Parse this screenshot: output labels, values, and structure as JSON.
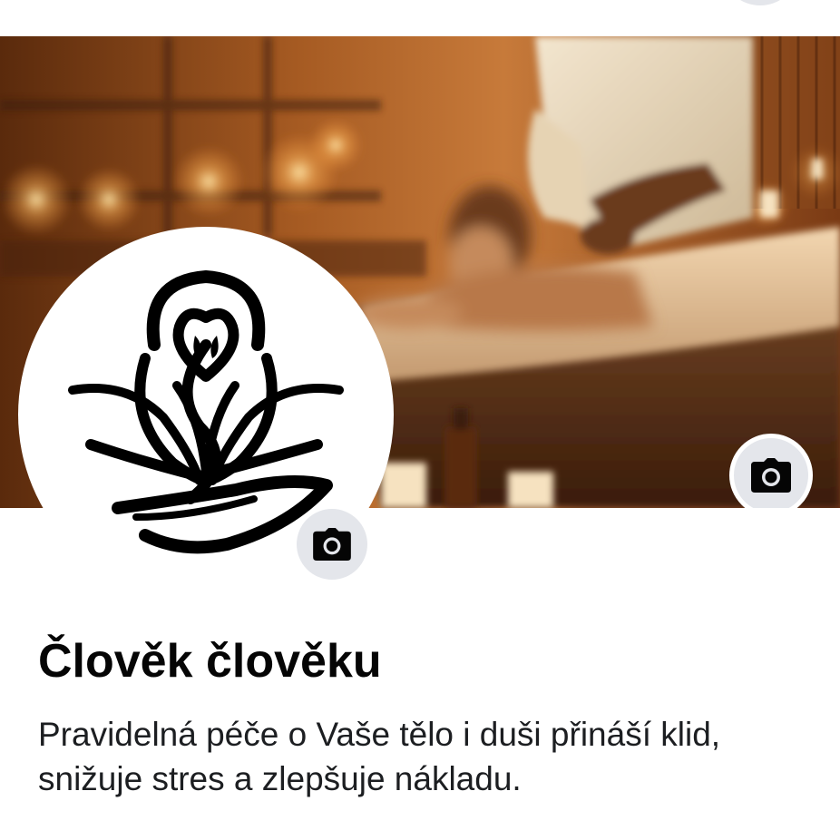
{
  "profile": {
    "name": "Člověk člověku",
    "bio": "Pravidelná péče o Vaše tělo i duši přináší klid, snižuje stres a zlepšuje nákladu."
  },
  "cover": {
    "description_icon": "massage-photo",
    "camera_icon": "camera-icon"
  },
  "profile_picture": {
    "logo_icon": "lotus-hand-heart-logo",
    "camera_icon": "camera-icon"
  },
  "colors": {
    "button_bg": "#e4e6eb",
    "text_primary": "#050505",
    "text_secondary": "#1c1e21"
  }
}
